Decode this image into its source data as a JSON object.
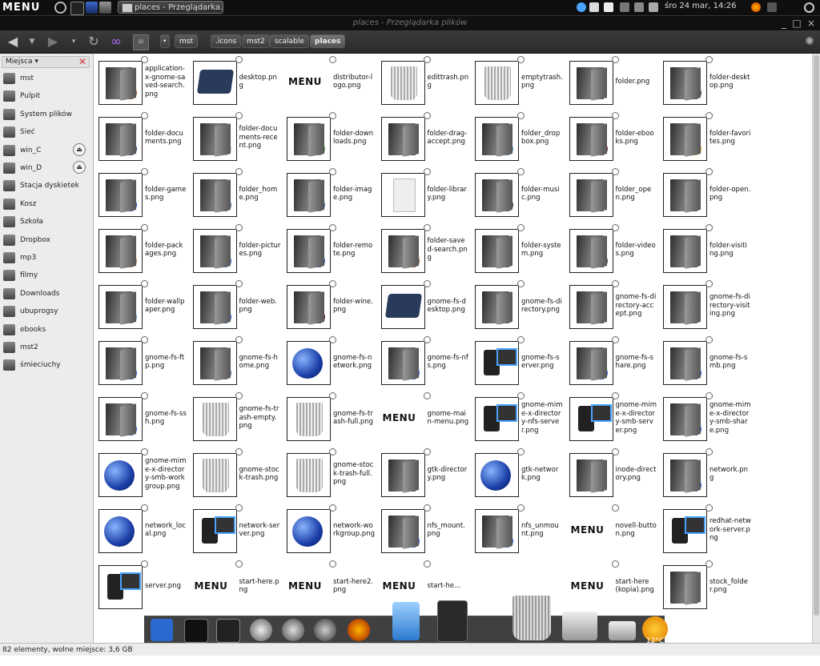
{
  "panel": {
    "logo": "MENU",
    "task_title": "places - Przeglądarka...",
    "clock": "śro 24 mar, 14:26"
  },
  "window": {
    "title": "places - Przeglądarka plików"
  },
  "breadcrumbs": [
    "mst",
    ".icons",
    "mst2",
    "scalable",
    "places"
  ],
  "sidebar": {
    "header": "Miejsca",
    "items": [
      {
        "label": "mst"
      },
      {
        "label": "Pulpit"
      },
      {
        "label": "System plików"
      },
      {
        "label": "Sieć"
      },
      {
        "label": "win_C",
        "eject": true
      },
      {
        "label": "win_D",
        "eject": true
      },
      {
        "label": "Stacja dyskietek"
      },
      {
        "label": "Kosz"
      },
      {
        "label": "Szkoła"
      },
      {
        "label": "Dropbox"
      },
      {
        "label": "mp3"
      },
      {
        "label": "filmy"
      },
      {
        "label": "Downloads"
      },
      {
        "label": "ubuprogsy"
      },
      {
        "label": "ebooks"
      },
      {
        "label": "mst2"
      },
      {
        "label": "śmieciuchy"
      }
    ]
  },
  "files": [
    {
      "name": "application-x-gnome-saved-search.png",
      "kind": "folder",
      "badge": "#b35a2a"
    },
    {
      "name": "desktop.png",
      "kind": "tablet"
    },
    {
      "name": "distributor-logo.png",
      "kind": "text"
    },
    {
      "name": "edittrash.png",
      "kind": "trash"
    },
    {
      "name": "emptytrash.png",
      "kind": "trash"
    },
    {
      "name": "folder.png",
      "kind": "folder"
    },
    {
      "name": "folder-desktop.png",
      "kind": "folder",
      "badge": "#3a4a6a"
    },
    {
      "name": "folder-documents.png",
      "kind": "folder",
      "badge": "#2a4a8a"
    },
    {
      "name": "folder-documents-recent.png",
      "kind": "folder",
      "badge": "#cfcfcf"
    },
    {
      "name": "folder-downloads.png",
      "kind": "folder",
      "badge": "#4caf2a"
    },
    {
      "name": "folder-drag-accept.png",
      "kind": "folder"
    },
    {
      "name": "folder_dropbox.png",
      "kind": "folder",
      "badge": "#4fa3e0"
    },
    {
      "name": "folder-ebooks.png",
      "kind": "folder",
      "badge": "#8a2a2a"
    },
    {
      "name": "folder-favorites.png",
      "kind": "folder",
      "badge": "#f2c21a"
    },
    {
      "name": "folder-games.png",
      "kind": "folder",
      "badge": "#2a50c0"
    },
    {
      "name": "folder_home.png",
      "kind": "folder",
      "badge": "#5a7aa0"
    },
    {
      "name": "folder-image.png",
      "kind": "folder",
      "badge": "#3a80d0"
    },
    {
      "name": "folder-library.png",
      "kind": "doc"
    },
    {
      "name": "folder-music.png",
      "kind": "folder",
      "badge": "#444"
    },
    {
      "name": "folder_open.png",
      "kind": "folder"
    },
    {
      "name": "folder-open.png",
      "kind": "folder"
    },
    {
      "name": "folder-packages.png",
      "kind": "folder",
      "badge": "#c8894a"
    },
    {
      "name": "folder-pictures.png",
      "kind": "folder",
      "badge": "#3a80d0"
    },
    {
      "name": "folder-remote.png",
      "kind": "folder",
      "badge": "#2a6ad0"
    },
    {
      "name": "folder-saved-search.png",
      "kind": "folder",
      "badge": "#b35a2a"
    },
    {
      "name": "folder-system.png",
      "kind": "folder"
    },
    {
      "name": "folder-videos.png",
      "kind": "folder",
      "badge": "#555"
    },
    {
      "name": "folder-visiting.png",
      "kind": "folder"
    },
    {
      "name": "folder-wallpaper.png",
      "kind": "folder",
      "badge": "#6aa0c0"
    },
    {
      "name": "folder-web.png",
      "kind": "folder",
      "badge": "#2a6ad0"
    },
    {
      "name": "folder-wine.png",
      "kind": "folder",
      "badge": "#7a1a1a"
    },
    {
      "name": "gnome-fs-desktop.png",
      "kind": "tablet"
    },
    {
      "name": "gnome-fs-directory.png",
      "kind": "folder"
    },
    {
      "name": "gnome-fs-directory-accept.png",
      "kind": "folder"
    },
    {
      "name": "gnome-fs-directory-visiting.png",
      "kind": "folder"
    },
    {
      "name": "gnome-fs-ftp.png",
      "kind": "folder",
      "badge": "#2a6ad0"
    },
    {
      "name": "gnome-fs-home.png",
      "kind": "folder",
      "badge": "#5a7aa0"
    },
    {
      "name": "gnome-fs-network.png",
      "kind": "globe"
    },
    {
      "name": "gnome-fs-nfs.png",
      "kind": "folder",
      "badge": "#2a6ad0"
    },
    {
      "name": "gnome-fs-server.png",
      "kind": "server"
    },
    {
      "name": "gnome-fs-share.png",
      "kind": "folder",
      "badge": "#2a6ad0"
    },
    {
      "name": "gnome-fs-smb.png",
      "kind": "folder",
      "badge": "#2a6ad0"
    },
    {
      "name": "gnome-fs-ssh.png",
      "kind": "folder",
      "badge": "#2a6ad0"
    },
    {
      "name": "gnome-fs-trash-empty.png",
      "kind": "trash"
    },
    {
      "name": "gnome-fs-trash-full.png",
      "kind": "trash"
    },
    {
      "name": "gnome-main-menu.png",
      "kind": "text"
    },
    {
      "name": "gnome-mime-x-directory-nfs-server.png",
      "kind": "server"
    },
    {
      "name": "gnome-mime-x-directory-smb-server.png",
      "kind": "server"
    },
    {
      "name": "gnome-mime-x-directory-smb-share.png",
      "kind": "folder",
      "badge": "#2a6ad0"
    },
    {
      "name": "gnome-mime-x-directory-smb-workgroup.png",
      "kind": "globe"
    },
    {
      "name": "gnome-stock-trash.png",
      "kind": "trash"
    },
    {
      "name": "gnome-stock-trash-full.png",
      "kind": "trash"
    },
    {
      "name": "gtk-directory.png",
      "kind": "folder"
    },
    {
      "name": "gtk-network.png",
      "kind": "globe"
    },
    {
      "name": "inode-directory.png",
      "kind": "folder"
    },
    {
      "name": "network.png",
      "kind": "folder",
      "badge": "#2a6ad0"
    },
    {
      "name": "network_local.png",
      "kind": "globe"
    },
    {
      "name": "network-server.png",
      "kind": "server"
    },
    {
      "name": "network-workgroup.png",
      "kind": "globe"
    },
    {
      "name": "nfs_mount.png",
      "kind": "folder",
      "badge": "#2a6ad0"
    },
    {
      "name": "nfs_unmount.png",
      "kind": "folder",
      "badge": "#2a6ad0"
    },
    {
      "name": "novell-button.png",
      "kind": "text"
    },
    {
      "name": "redhat-network-server.png",
      "kind": "server"
    },
    {
      "name": "server.png",
      "kind": "server"
    },
    {
      "name": "start-here.png",
      "kind": "text"
    },
    {
      "name": "start-here2.png",
      "kind": "text"
    },
    {
      "name": "start-he...",
      "kind": "text"
    },
    {
      "name": "",
      "kind": "none"
    },
    {
      "name": "start-here (kopia).png",
      "kind": "text"
    },
    {
      "name": "stock_folder.png",
      "kind": "folder"
    }
  ],
  "statusbar": {
    "text": "82 elementy, wolne miejsce: 3,6 GB"
  },
  "weather": {
    "temp": "12°C"
  },
  "colors": {
    "panel": "#0f0f0f",
    "sidebar": "#ececec",
    "accent": "#4aa3ff"
  }
}
